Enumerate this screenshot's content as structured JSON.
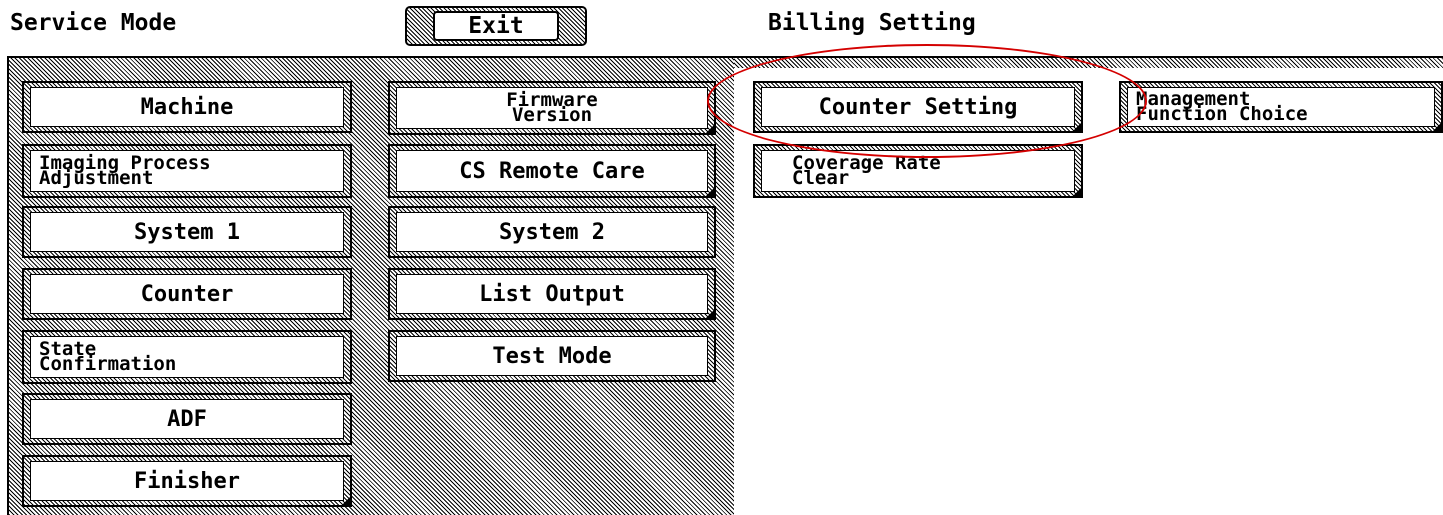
{
  "header": {
    "service_mode": "Service Mode",
    "exit_label": "Exit",
    "billing_setting": "Billing Setting"
  },
  "left_menu": {
    "col1": {
      "machine": "Machine",
      "imaging_1": "Imaging Process",
      "imaging_2": "Adjustment",
      "system1": "System 1",
      "counter": "Counter",
      "state_1": "State",
      "state_2": "Confirmation",
      "adf": "ADF",
      "finisher": "Finisher"
    },
    "col2": {
      "firmware_1": "Firmware",
      "firmware_2": "Version",
      "cs_remote": "CS Remote Care",
      "system2": "System 2",
      "list_output": "List Output",
      "test_mode": "Test Mode"
    }
  },
  "billing_menu": {
    "counter_setting": "Counter Setting",
    "management_1": "Management",
    "management_2": "Function Choice",
    "coverage_1": "Coverage Rate",
    "coverage_2": "Clear"
  },
  "highlight_color": "#d40000"
}
